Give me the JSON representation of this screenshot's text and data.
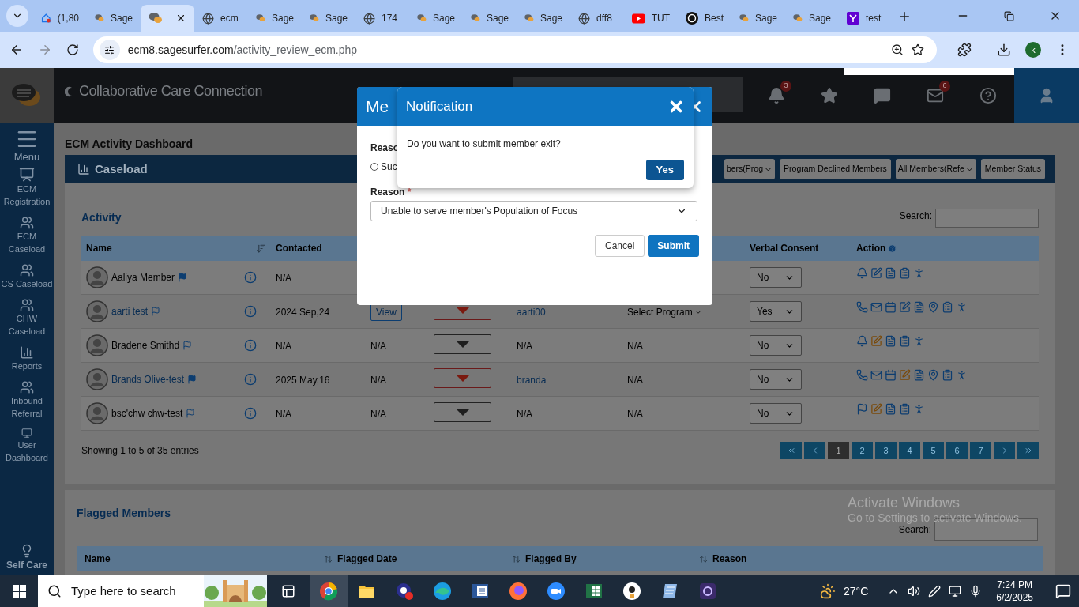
{
  "browser": {
    "tabs": [
      {
        "title": "(1,80",
        "kind": "alert",
        "selected": false
      },
      {
        "title": "Sage",
        "kind": "chat",
        "selected": false
      },
      {
        "kind": "chat",
        "selected": true
      },
      {
        "title": "ecm",
        "kind": "globe",
        "selected": false
      },
      {
        "title": "Sage",
        "kind": "chat",
        "selected": false
      },
      {
        "title": "Sage",
        "kind": "chat",
        "selected": false
      },
      {
        "title": "174",
        "kind": "globe",
        "selected": false
      },
      {
        "title": "Sage",
        "kind": "chat",
        "selected": false
      },
      {
        "title": "Sage",
        "kind": "chat",
        "selected": false
      },
      {
        "title": "Sage",
        "kind": "chat",
        "selected": false
      },
      {
        "title": "dff8",
        "kind": "globe",
        "selected": false
      },
      {
        "title": "TUT",
        "kind": "video",
        "selected": false
      },
      {
        "title": "Best",
        "kind": "swirl",
        "selected": false
      },
      {
        "title": "Sage",
        "kind": "chat",
        "selected": false
      },
      {
        "title": "Sage",
        "kind": "chat",
        "selected": false
      },
      {
        "title": "test",
        "kind": "square",
        "selected": false
      }
    ],
    "url": {
      "host": "ecm8.sagesurfer.com",
      "path": "/activity_review_ecm.php"
    },
    "profile": "k"
  },
  "header": {
    "brand": "Collaborative Care Connection",
    "icons": [
      {
        "kind": "bell",
        "badge": "3"
      },
      {
        "kind": "star"
      },
      {
        "kind": "chat"
      },
      {
        "kind": "mail",
        "badge": "6"
      },
      {
        "kind": "help"
      }
    ]
  },
  "sidebar": {
    "items": [
      {
        "label": "Menu",
        "kind": "menu"
      },
      {
        "label": "ECM Registration",
        "kind": "registration"
      },
      {
        "label": "ECM Caseload",
        "kind": "users"
      },
      {
        "label": "CS Caseload",
        "kind": "users"
      },
      {
        "label": "CHW Caseload",
        "kind": "users"
      },
      {
        "label": "Reports",
        "kind": "reports"
      },
      {
        "label": "Inbound Referral",
        "kind": "users"
      },
      {
        "label": "User Dashboard",
        "kind": "monitor"
      }
    ],
    "footer": {
      "label": "Self Care"
    }
  },
  "page_title": "ECM Activity Dashboard",
  "caseload": {
    "title": "Caseload",
    "controls": [
      {
        "kind": "select",
        "label": "bers(Prog"
      },
      {
        "kind": "button",
        "label": "Program Declined Members"
      },
      {
        "kind": "select",
        "label": "All Members(Refe"
      },
      {
        "kind": "button",
        "label": "Member Status"
      }
    ]
  },
  "activity": {
    "title": "Activity",
    "search_label": "Search:",
    "columns": {
      "name": "Name",
      "contacted": "Contacted",
      "consent": "Verbal Consent",
      "action": "Action"
    },
    "rows": [
      {
        "name": "Aaliya Member",
        "link": false,
        "flagged": true,
        "contacted": "N/A",
        "consent": "No",
        "actions": [
          {
            "kind": "bell"
          },
          {
            "kind": "edit"
          },
          {
            "kind": "report"
          },
          {
            "kind": "notes"
          },
          {
            "kind": "exit"
          }
        ]
      },
      {
        "name": "aarti test",
        "link": true,
        "flagged": false,
        "contacted": "2024 Sep,24",
        "column_3": {
          "kind": "button",
          "text": "View"
        },
        "status": {
          "kind": "alert"
        },
        "column_5": {
          "text": "aarti00",
          "link": true
        },
        "column_6": {
          "kind": "menu",
          "text": "Select Program"
        },
        "consent": "Yes",
        "actions": [
          {
            "kind": "phone"
          },
          {
            "kind": "mail"
          },
          {
            "kind": "calendar"
          },
          {
            "kind": "edit"
          },
          {
            "kind": "report"
          },
          {
            "kind": "pin"
          },
          {
            "kind": "notes"
          },
          {
            "kind": "exit"
          }
        ]
      },
      {
        "name": "Bradene Smithd",
        "link": false,
        "flagged": false,
        "contacted": "N/A",
        "column_3": {
          "kind": "text",
          "text": "N/A"
        },
        "status": {
          "kind": "normal"
        },
        "column_5": {
          "text": "N/A",
          "link": false
        },
        "column_6": {
          "kind": "text",
          "text": "N/A"
        },
        "consent": "No",
        "actions": [
          {
            "kind": "bell"
          },
          {
            "kind": "edit_flagged"
          },
          {
            "kind": "report"
          },
          {
            "kind": "notes"
          },
          {
            "kind": "exit"
          }
        ]
      },
      {
        "name": "Brands Olive-test",
        "link": true,
        "flagged": true,
        "contacted": "2025 May,16",
        "column_3": {
          "kind": "text",
          "text": "N/A"
        },
        "status": {
          "kind": "alert"
        },
        "column_5": {
          "text": "branda",
          "link": true
        },
        "column_6": {
          "kind": "text",
          "text": "N/A"
        },
        "consent": "No",
        "actions": [
          {
            "kind": "phone"
          },
          {
            "kind": "mail"
          },
          {
            "kind": "calendar"
          },
          {
            "kind": "edit_flagged"
          },
          {
            "kind": "report"
          },
          {
            "kind": "pin"
          },
          {
            "kind": "notes"
          },
          {
            "kind": "exit"
          }
        ]
      },
      {
        "name": "bsc'chw chw-test",
        "link": false,
        "flagged": false,
        "contacted": "N/A",
        "column_3": {
          "kind": "text",
          "text": "N/A"
        },
        "status": {
          "kind": "normal"
        },
        "column_5": {
          "text": "N/A",
          "link": false
        },
        "column_6": {
          "kind": "text",
          "text": "N/A"
        },
        "consent": "No",
        "actions": [
          {
            "kind": "flag"
          },
          {
            "kind": "edit_flagged"
          },
          {
            "kind": "report"
          },
          {
            "kind": "notes"
          },
          {
            "kind": "exit"
          }
        ]
      }
    ],
    "footer": "Showing 1 to 5 of 35 entries",
    "pagination": [
      {
        "kind": "first"
      },
      {
        "kind": "prev"
      },
      {
        "kind": "page",
        "label": "1",
        "selected": true
      },
      {
        "kind": "page",
        "label": "2",
        "selected": false
      },
      {
        "kind": "page",
        "label": "3",
        "selected": false
      },
      {
        "kind": "page",
        "label": "4",
        "selected": false
      },
      {
        "kind": "page",
        "label": "5",
        "selected": false
      },
      {
        "kind": "page",
        "label": "6",
        "selected": false
      },
      {
        "kind": "page",
        "label": "7",
        "selected": false
      },
      {
        "kind": "next"
      },
      {
        "kind": "last"
      }
    ]
  },
  "flagged": {
    "title": "Flagged Members",
    "search_label": "Search:",
    "columns": [
      "Name",
      "Flagged Date",
      "Flagged By",
      "Reason"
    ]
  },
  "exit_dialog": {
    "title": "Me",
    "fields": [
      {
        "kind": "radio",
        "label": "Reaso",
        "options": [
          {
            "label": "Suc",
            "selected": false
          }
        ]
      },
      {
        "kind": "select",
        "label": "Reason",
        "marker": "*",
        "value": "Unable to serve member's Population of Focus"
      }
    ],
    "buttons": [
      {
        "label": "Cancel",
        "kind": "secondary"
      },
      {
        "label": "Submit",
        "kind": "primary"
      }
    ]
  },
  "notification": {
    "title": "Notification",
    "message": "Do you want to submit member exit?",
    "button": "Yes"
  },
  "os_watermark": {
    "title": "Activate Windows",
    "text": "Go to Settings to activate Windows."
  },
  "taskbar": {
    "search_placeholder": "Type here to search",
    "apps": [
      {
        "kind": "browser",
        "selected": true
      },
      {
        "kind": "folder",
        "selected": false
      },
      {
        "kind": "badge-app",
        "selected": false
      },
      {
        "kind": "wave",
        "selected": false
      },
      {
        "kind": "document",
        "selected": false
      },
      {
        "kind": "fox",
        "selected": false
      },
      {
        "kind": "video",
        "selected": false
      },
      {
        "kind": "spreadsheet",
        "selected": false
      },
      {
        "kind": "camera",
        "selected": false
      },
      {
        "kind": "notebook",
        "selected": false
      },
      {
        "kind": "ring-app",
        "selected": false
      }
    ],
    "weather": "27°C",
    "time": "7:24 PM",
    "date": "6/2/2025"
  }
}
